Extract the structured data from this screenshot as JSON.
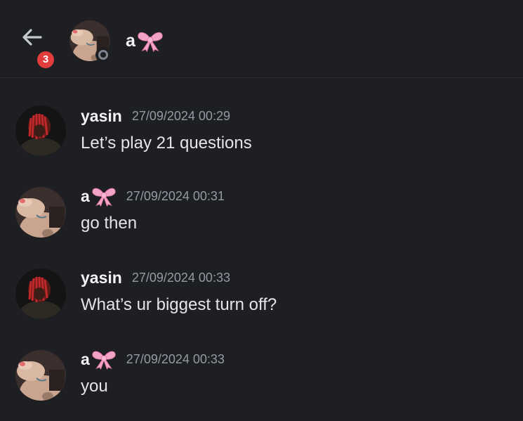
{
  "header": {
    "back_label": "Back",
    "unread_count": "3",
    "channel_name": "a",
    "channel_emoji": "pink-bow",
    "status": "offline"
  },
  "messages": [
    {
      "author": "yasin",
      "author_emoji": "",
      "timestamp": "27/09/2024 00:29",
      "text": "Let’s play 21 questions",
      "avatar": "red-hair-avatar"
    },
    {
      "author": "a",
      "author_emoji": "pink-bow",
      "timestamp": "27/09/2024 00:31",
      "text": "go then",
      "avatar": "hand-avatar"
    },
    {
      "author": "yasin",
      "author_emoji": "",
      "timestamp": "27/09/2024 00:33",
      "text": "What’s ur biggest turn off?",
      "avatar": "red-hair-avatar"
    },
    {
      "author": "a",
      "author_emoji": "pink-bow",
      "timestamp": "27/09/2024 00:33",
      "text": "you",
      "avatar": "hand-avatar"
    }
  ],
  "colors": {
    "background": "#1e1f23",
    "badge": "#e23d3d",
    "timestamp": "#949ba4",
    "bow": "#f4a3c8"
  }
}
